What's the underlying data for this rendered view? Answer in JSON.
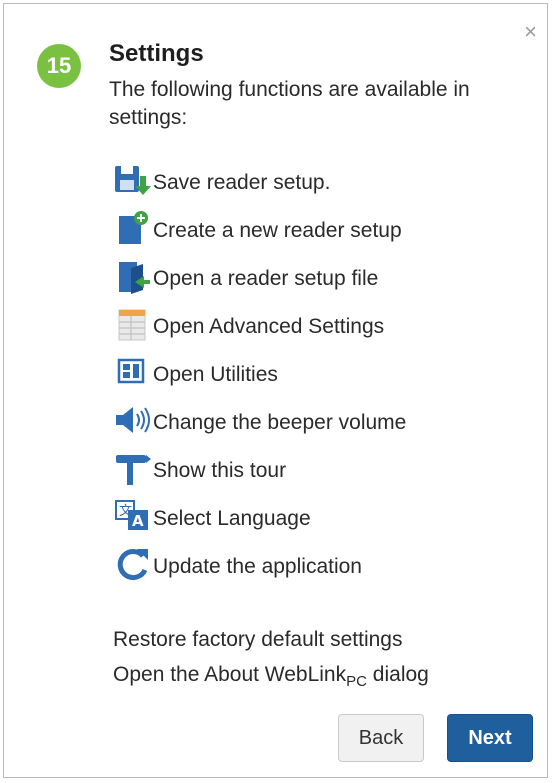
{
  "dialog": {
    "close_glyph": "×",
    "step_number": "15",
    "title": "Settings",
    "subtitle": "The following functions are available in settings:"
  },
  "items": [
    {
      "icon": "save-icon",
      "label": "Save reader setup."
    },
    {
      "icon": "new-file-icon",
      "label": "Create a new reader setup"
    },
    {
      "icon": "open-file-icon",
      "label": "Open a reader setup file"
    },
    {
      "icon": "settings-table-icon",
      "label": "Open Advanced Settings"
    },
    {
      "icon": "utilities-icon",
      "label": "Open Utilities"
    },
    {
      "icon": "speaker-volume-icon",
      "label": "Change the beeper volume"
    },
    {
      "icon": "signpost-icon",
      "label": "Show this tour"
    },
    {
      "icon": "language-icon",
      "label": "Select Language"
    },
    {
      "icon": "refresh-icon",
      "label": "Update the application"
    }
  ],
  "extra": {
    "restore": "Restore factory default settings",
    "about_prefix": "Open the About WebLink",
    "about_sub": "PC",
    "about_suffix": " dialog"
  },
  "buttons": {
    "back": "Back",
    "next": "Next"
  },
  "colors": {
    "step_badge": "#7ac142",
    "icon_blue": "#2f6db5",
    "icon_green": "#3ea342",
    "next_button": "#1f5f9e"
  }
}
